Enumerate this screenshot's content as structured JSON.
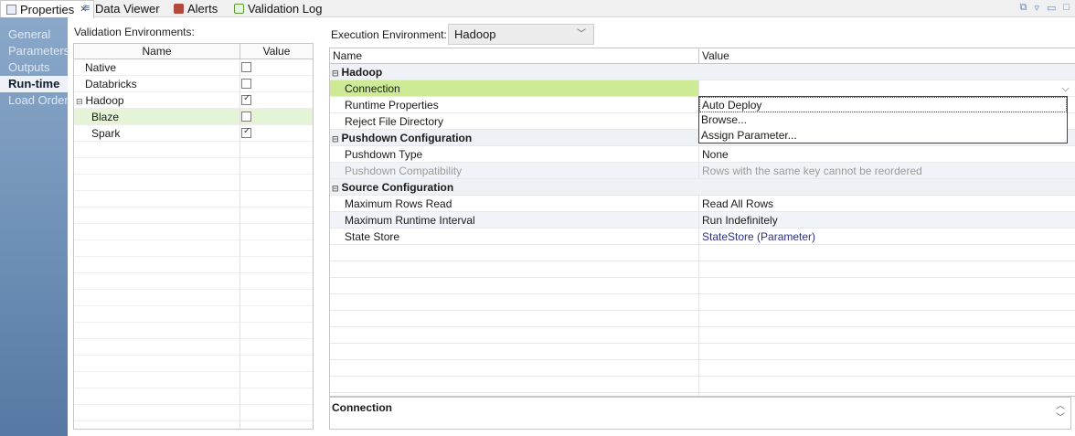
{
  "tabs": [
    {
      "label": "Properties",
      "icon": "properties-icon",
      "active": true
    },
    {
      "label": "Data Viewer",
      "icon": "data-viewer-icon",
      "active": false
    },
    {
      "label": "Alerts",
      "icon": "alerts-icon",
      "active": false
    },
    {
      "label": "Validation Log",
      "icon": "validation-log-icon",
      "active": false
    }
  ],
  "leftnav": {
    "items": [
      "General",
      "Parameters",
      "Outputs",
      "Run-time",
      "Load Order"
    ],
    "active": "Run-time"
  },
  "validation": {
    "label": "Validation Environments:",
    "col_name": "Name",
    "col_value": "Value",
    "rows": [
      {
        "name": "Native",
        "checked": false
      },
      {
        "name": "Databricks",
        "checked": false
      },
      {
        "name": "Hadoop",
        "checked": true,
        "expander": "⊟"
      },
      {
        "name": "Blaze",
        "checked": false,
        "selected": true
      },
      {
        "name": "Spark",
        "checked": true
      }
    ]
  },
  "execution": {
    "label": "Execution Environment:",
    "value": "Hadoop"
  },
  "grid": {
    "col_name": "Name",
    "col_value": "Value",
    "rows": [
      {
        "type": "group",
        "name": "Hadoop",
        "expander": "⊟"
      },
      {
        "name": "Connection",
        "value": "",
        "selected": true
      },
      {
        "name": "Runtime Properties",
        "value": ""
      },
      {
        "name": "Reject File Directory",
        "value": ""
      },
      {
        "type": "group",
        "name": "Pushdown Configuration",
        "expander": "⊟"
      },
      {
        "name": "Pushdown Type",
        "value": "None"
      },
      {
        "name": "Pushdown Compatibility",
        "value": "Rows with the same key cannot be reordered",
        "disabled": true
      },
      {
        "type": "group",
        "name": "Source Configuration",
        "expander": "⊟"
      },
      {
        "name": "Maximum Rows Read",
        "value": "Read All Rows"
      },
      {
        "name": "Maximum Runtime Interval",
        "value": "Run Indefinitely"
      },
      {
        "name": "State Store",
        "value": "StateStore (Parameter)",
        "link": true
      }
    ]
  },
  "dropdown": {
    "options": [
      "Auto Deploy",
      "Browse...",
      "Assign Parameter..."
    ]
  },
  "description": {
    "title": "Connection"
  },
  "colors": {
    "nav_top": "#8aa8c9",
    "nav_bottom": "#5678a2",
    "selected_row": "#cdeb95",
    "selected_env": "#e5f3d6",
    "link": "#2a2f8f"
  }
}
